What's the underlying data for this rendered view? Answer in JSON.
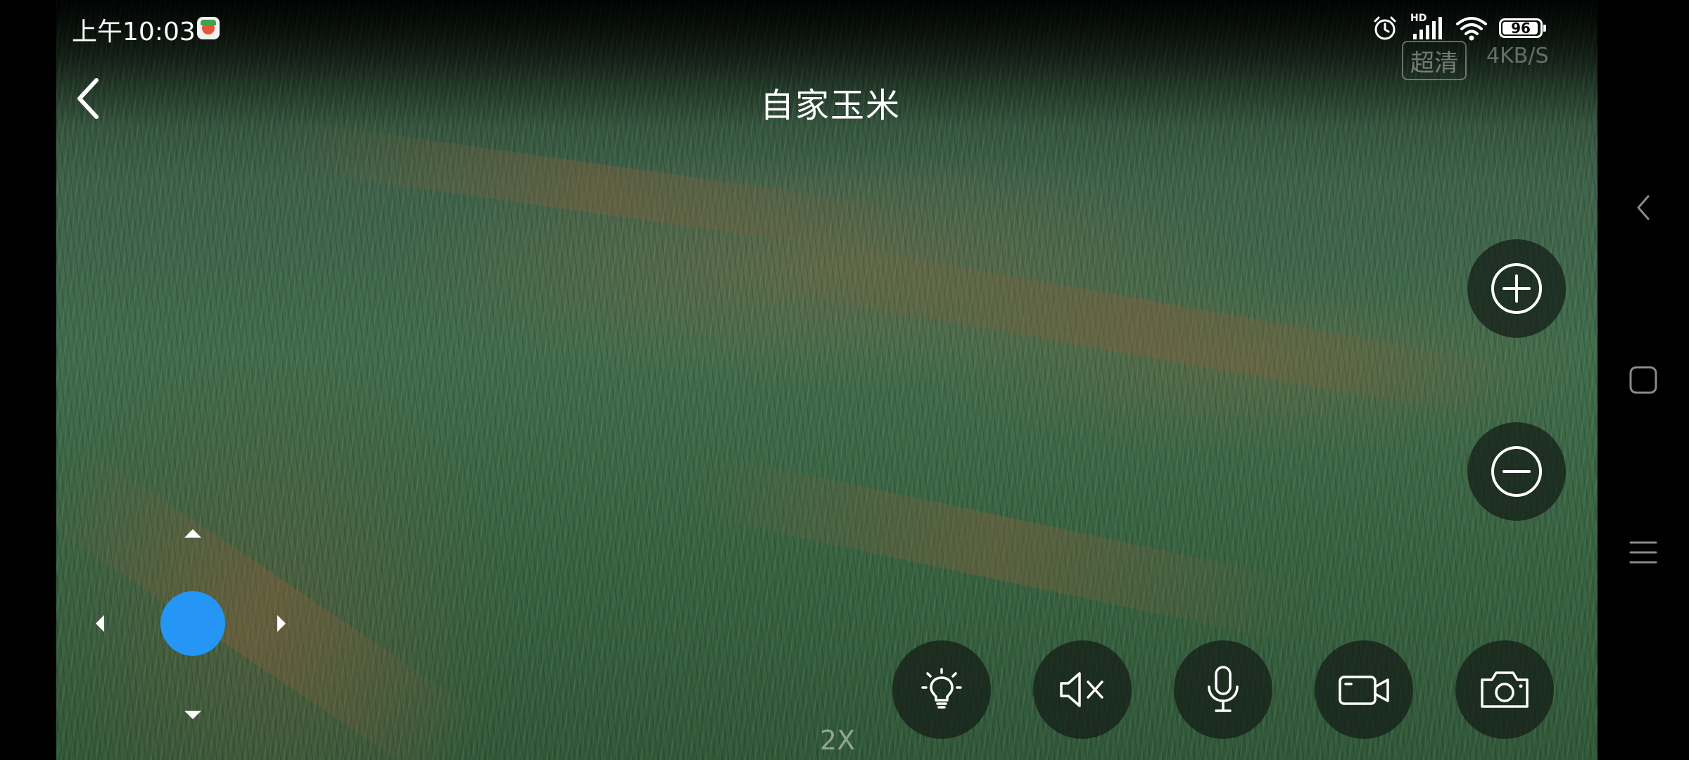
{
  "status_bar": {
    "time": "上午10:03",
    "network_label": "HD",
    "battery_level": "96",
    "battery_fraction": 0.96
  },
  "header": {
    "title": "自家玉米",
    "quality_label": "超清",
    "speed": "4KB/S"
  },
  "controls": {
    "zoom_level": "2X",
    "buttons": [
      {
        "name": "light",
        "icon": "lightbulb-icon"
      },
      {
        "name": "mute",
        "icon": "speaker-muted-icon"
      },
      {
        "name": "talk",
        "icon": "microphone-icon"
      },
      {
        "name": "record",
        "icon": "video-camera-icon"
      },
      {
        "name": "snapshot",
        "icon": "camera-icon"
      }
    ],
    "zoom_in_icon": "plus-circle-icon",
    "zoom_out_icon": "minus-circle-icon"
  },
  "colors": {
    "joystick_knob": "#2595f6",
    "control_bg": "rgba(20,28,22,0.72)"
  }
}
